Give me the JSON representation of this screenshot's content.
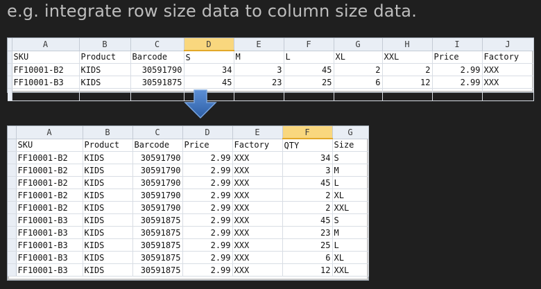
{
  "caption": "e.g. integrate row size data to column size data.",
  "sheet1": {
    "columns": [
      "A",
      "B",
      "C",
      "D",
      "E",
      "F",
      "G",
      "H",
      "I",
      "J"
    ],
    "selected_column": "D",
    "header_row": [
      "SKU",
      "Product",
      "Barcode",
      "S",
      "M",
      "L",
      "XL",
      "XXL",
      "Price",
      "Factory"
    ],
    "rows": [
      [
        "FF10001-B2",
        "KIDS",
        "30591790",
        "34",
        "3",
        "45",
        "2",
        "2",
        "2.99",
        "XXX"
      ],
      [
        "FF10001-B3",
        "KIDS",
        "30591875",
        "45",
        "23",
        "25",
        "6",
        "12",
        "2.99",
        "XXX"
      ]
    ]
  },
  "sheet2": {
    "columns": [
      "A",
      "B",
      "C",
      "D",
      "E",
      "F",
      "G"
    ],
    "selected_column": "F",
    "header_row": [
      "SKU",
      "Product",
      "Barcode",
      "Price",
      "Factory",
      "QTY",
      "Size"
    ],
    "rows": [
      [
        "FF10001-B2",
        "KIDS",
        "30591790",
        "2.99",
        "XXX",
        "34",
        "S"
      ],
      [
        "FF10001-B2",
        "KIDS",
        "30591790",
        "2.99",
        "XXX",
        "3",
        "M"
      ],
      [
        "FF10001-B2",
        "KIDS",
        "30591790",
        "2.99",
        "XXX",
        "45",
        "L"
      ],
      [
        "FF10001-B2",
        "KIDS",
        "30591790",
        "2.99",
        "XXX",
        "2",
        "XL"
      ],
      [
        "FF10001-B2",
        "KIDS",
        "30591790",
        "2.99",
        "XXX",
        "2",
        "XXL"
      ],
      [
        "FF10001-B3",
        "KIDS",
        "30591875",
        "2.99",
        "XXX",
        "45",
        "S"
      ],
      [
        "FF10001-B3",
        "KIDS",
        "30591875",
        "2.99",
        "XXX",
        "23",
        "M"
      ],
      [
        "FF10001-B3",
        "KIDS",
        "30591875",
        "2.99",
        "XXX",
        "25",
        "L"
      ],
      [
        "FF10001-B3",
        "KIDS",
        "30591875",
        "2.99",
        "XXX",
        "6",
        "XL"
      ],
      [
        "FF10001-B3",
        "KIDS",
        "30591875",
        "2.99",
        "XXX",
        "12",
        "XXL"
      ]
    ]
  },
  "colors": {
    "background": "#1f1f1f",
    "caption_text": "#bdbdbd",
    "selected_column_header": "#f9d77e",
    "arrow": "#3b6fb6"
  },
  "icons": {
    "arrow": "down-arrow-icon"
  }
}
